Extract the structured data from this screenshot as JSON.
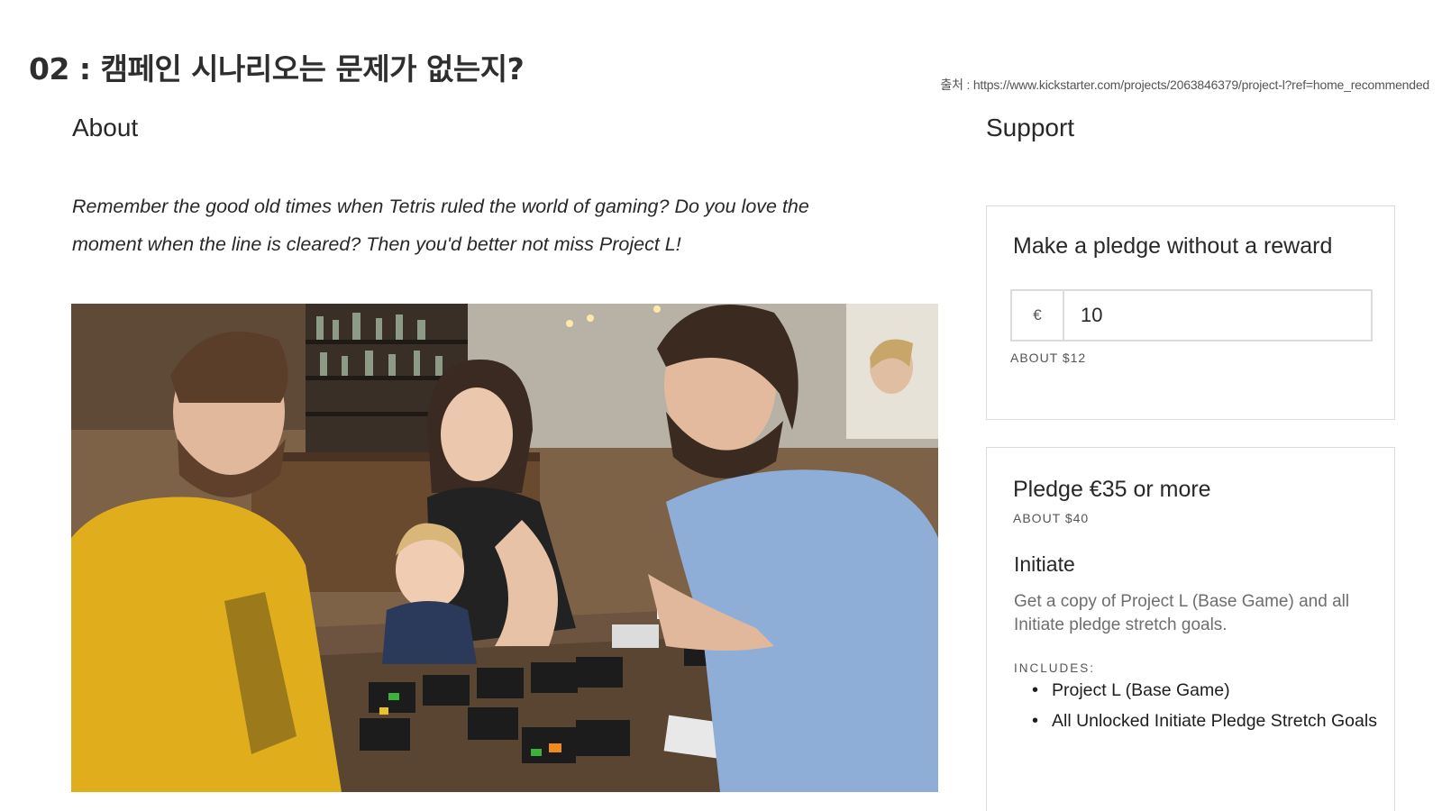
{
  "slide": {
    "title": "02 : 캠페인 시나리오는 문제가 없는지?",
    "source": "출처 : https://www.kickstarter.com/projects/2063846379/project-l?ref=home_recommended"
  },
  "about": {
    "heading": "About",
    "intro": "Remember the good old times when Tetris ruled the world of gaming? Do you love the moment when the line is cleared? Then you'd better not miss Project L!"
  },
  "support": {
    "heading": "Support",
    "no_reward": {
      "title": "Make a pledge without a reward",
      "currency_symbol": "€",
      "amount": "10",
      "approx": "ABOUT $12"
    },
    "tier": {
      "title": "Pledge €35 or more",
      "approx": "ABOUT $40",
      "name": "Initiate",
      "description": "Get a copy of Project L (Base Game) and all Initiate pledge stretch goals.",
      "includes_label": "INCLUDES:",
      "includes": [
        "Project L (Base Game)",
        "All Unlocked Initiate Pledge Stretch Goals"
      ]
    }
  },
  "colors": {
    "text": "#282828",
    "muted": "#6e6e6e",
    "border": "#dcdcdc",
    "shirt_yellow": "#e0ad1d",
    "shirt_blue": "#8eaed8"
  }
}
